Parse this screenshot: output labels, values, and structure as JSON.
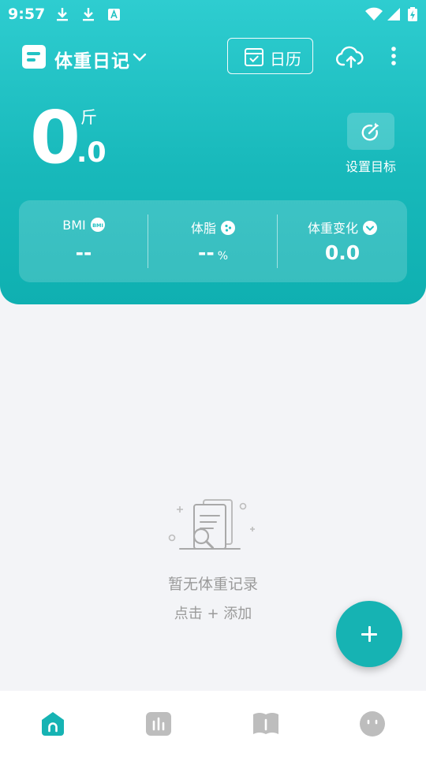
{
  "status_bar": {
    "time": "9:57",
    "icons": [
      "download-icon",
      "download-icon",
      "text-a-icon",
      "wifi-icon",
      "signal-icon",
      "battery-charging-icon"
    ]
  },
  "top_bar": {
    "title": "体重日记",
    "calendar_label": "日历",
    "icons": [
      "notebook-icon",
      "chevron-down-icon",
      "calendar-check-icon",
      "cloud-upload-icon",
      "more-vertical-icon"
    ]
  },
  "weight": {
    "integer": "0",
    "decimal": ".0",
    "unit": "斤"
  },
  "goal": {
    "label": "设置目标",
    "icon": "target-dart-icon"
  },
  "stats": {
    "bmi": {
      "label": "BMI",
      "value": "--"
    },
    "body_fat": {
      "label": "体脂",
      "value": "--",
      "unit": "%"
    },
    "change": {
      "label": "体重变化",
      "value": "0.0"
    }
  },
  "empty_state": {
    "title": "暂无体重记录",
    "hint": "点击 + 添加"
  },
  "bottom_nav": {
    "items": [
      "home-icon",
      "stats-bars-icon",
      "book-icon",
      "profile-face-icon"
    ],
    "active": 0
  },
  "colors": {
    "header_top": "#2ecdd0",
    "header_bottom": "#0fb0b1",
    "accent": "#16b3b3",
    "background": "#f3f4f7",
    "inactive_nav": "#bdbdbd",
    "empty_text": "#9a9a9a"
  }
}
